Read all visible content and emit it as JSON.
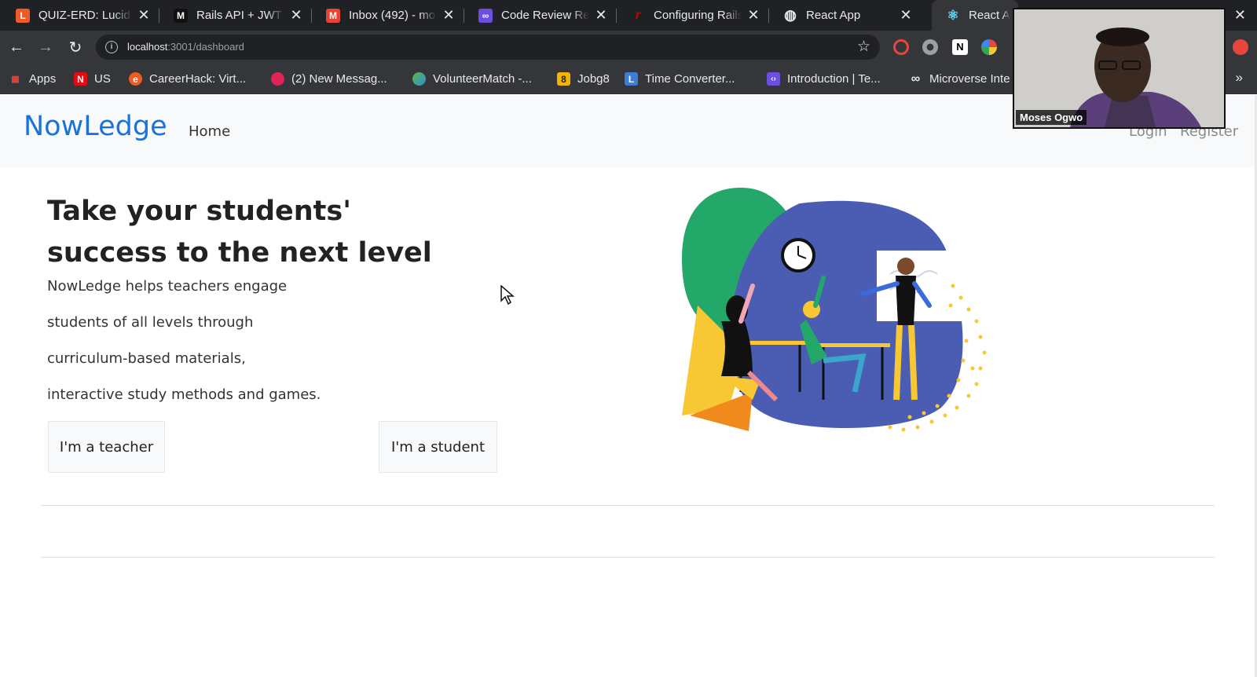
{
  "browser": {
    "tabs": [
      {
        "title": "QUIZ-ERD: Lucid",
        "icon": "lucid-icon",
        "color": "#f05a28",
        "glyph": "L"
      },
      {
        "title": "Rails API + JWT",
        "icon": "medium-icon",
        "color": "#111111",
        "glyph": "M"
      },
      {
        "title": "Inbox (492) - mo",
        "icon": "gmail-icon",
        "color": "#ea4335",
        "glyph": "M"
      },
      {
        "title": "Code Review Re",
        "icon": "microverse-icon",
        "color": "#6c4fe0",
        "glyph": "∞"
      },
      {
        "title": "Configuring Rails",
        "icon": "rails-icon",
        "color": "#cc0000",
        "glyph": "r"
      },
      {
        "title": "React App",
        "icon": "globe-icon",
        "color": "#e8eaed",
        "glyph": "◍"
      },
      {
        "title": "React A",
        "icon": "react-icon",
        "color": "#61dafb",
        "glyph": "⚛"
      }
    ],
    "url_host": "localhost",
    "url_rest": ":3001/dashboard",
    "bookmarks": [
      {
        "label": "Apps",
        "icon": "apps-grid-icon",
        "color": "#ea4335",
        "glyph": "⁞⁞⁞"
      },
      {
        "label": "US",
        "icon": "netflix-icon",
        "color": "#e50914",
        "glyph": "N"
      },
      {
        "label": "CareerHack: Virt...",
        "icon": "careerhack-icon",
        "color": "#f15a24",
        "glyph": "e"
      },
      {
        "label": "(2) New Messag...",
        "icon": "messenger-icon",
        "color": "#e02454",
        "glyph": "●"
      },
      {
        "label": "VolunteerMatch -...",
        "icon": "volunteermatch-icon",
        "color": "#5bb547",
        "glyph": "✿"
      },
      {
        "label": "Jobg8",
        "icon": "jobg8-icon",
        "color": "#f5b400",
        "glyph": "8"
      },
      {
        "label": "Time Converter...",
        "icon": "time-converter-icon",
        "color": "#3b7dd8",
        "glyph": "L"
      },
      {
        "label": "Introduction | Te...",
        "icon": "code-icon",
        "color": "#6c4fe0",
        "glyph": "‹›"
      },
      {
        "label": "Microverse Inte",
        "icon": "microverse-icon",
        "color": "#35363a",
        "glyph": "∞"
      }
    ]
  },
  "webcam": {
    "name": "Moses Ogwo"
  },
  "navbar": {
    "brand": "NowLedge",
    "home": "Home",
    "login": "Login",
    "register": "Register"
  },
  "hero": {
    "title": "Take your students' success to the next level",
    "lines": [
      "NowLedge helps teachers engage",
      "students of all levels through",
      "curriculum-based materials,",
      "interactive study methods and games."
    ],
    "teacher_button": "I'm a teacher",
    "student_button": "I'm a student"
  },
  "colors": {
    "brand": "#1a73d9",
    "illustration_blob": "#4a5db3",
    "illustration_green": "#23a86a",
    "illustration_yellow": "#f7c734",
    "illustration_orange": "#f08a1c"
  }
}
